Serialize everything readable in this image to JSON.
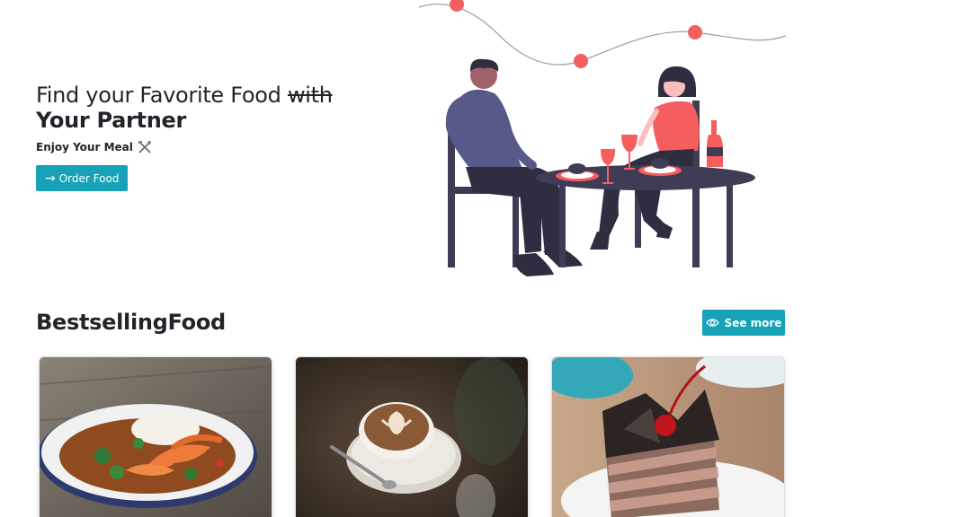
{
  "hero": {
    "title_plain": "Find your Favorite Food",
    "title_strike": "with",
    "title_bold": "Your Partner",
    "subtitle": "Enjoy Your Meal",
    "order_button_label": "Order Food"
  },
  "section": {
    "title_plain": "Bestselling",
    "title_bold": "Food",
    "see_more_label": "See more"
  },
  "icons": {
    "order": "arrow-right-icon",
    "subtitle": "utensils-icon",
    "see_more": "eye-icon"
  },
  "cards": [
    {
      "image": "shrimp-curry-bowl"
    },
    {
      "image": "latte-art-coffee-cup"
    },
    {
      "image": "chocolate-layer-cake-with-cherry"
    }
  ],
  "colors": {
    "accent": "#17a2b8",
    "illustration_red": "#f55e5e",
    "illustration_dark": "#3f3d56"
  }
}
